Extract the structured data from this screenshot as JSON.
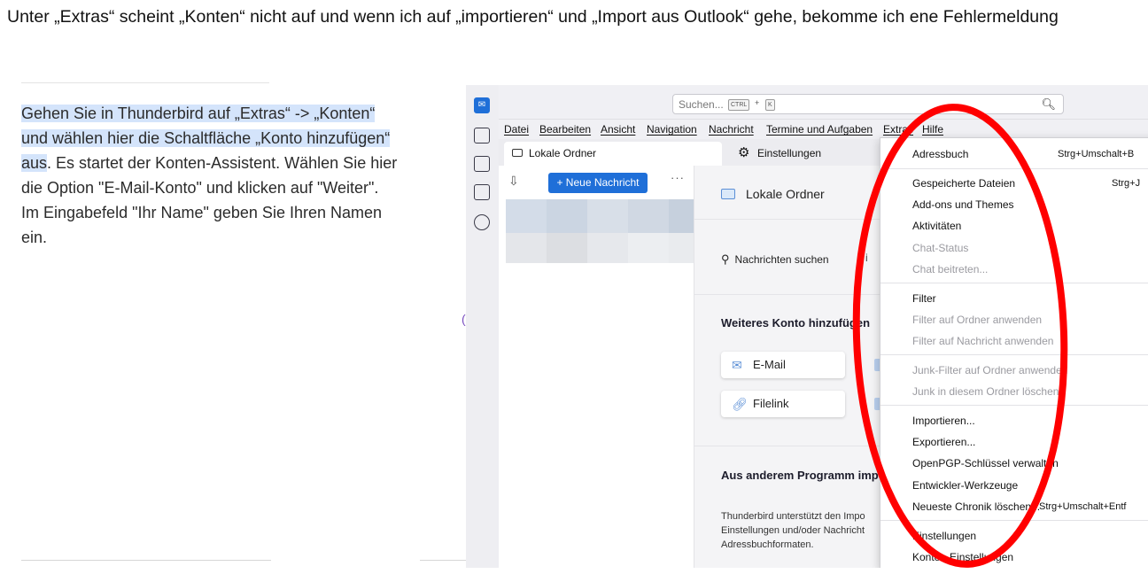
{
  "caption": "Unter „Extras“ scheint „Konten“ nicht auf und wenn ich auf „importieren“ und „Import aus Outlook“ gehe, bekomme ich ene Fehlermeldung",
  "help": {
    "line1": "Gehen Sie in Thunderbird auf „Extras“ -> „Konten“",
    "line2": "und wählen hier die Schaltfläche „Konto hinzufügen“",
    "line3a": "aus",
    "line3b": ". Es startet der Konten-Assistent. Wählen Sie hier",
    "line4": "die Option \"E-Mail-Konto\" und klicken auf \"Weiter\".",
    "line5": "Im Eingabefeld \"Ihr Name\" geben Sie Ihren Namen",
    "line6": "ein."
  },
  "toolbar": {
    "search_placeholder": "Suchen...",
    "kbd_ctrl": "CTRL",
    "kbd_plus": "+",
    "kbd_k": "K"
  },
  "menubar": [
    "Datei",
    "Bearbeiten",
    "Ansicht",
    "Navigation",
    "Nachricht",
    "Termine und Aufgaben",
    "Extras",
    "Hilfe"
  ],
  "tabs": {
    "folders": "Lokale Ordner",
    "settings": "Einstellungen"
  },
  "folderpane": {
    "new_message": "+ Neue Nachricht",
    "more": "···"
  },
  "content": {
    "folder_title": "Lokale Ordner",
    "search_messages": "Nachrichten suchen",
    "add_account": "Weiteres Konto hinzufügen",
    "email": "E-Mail",
    "filelink": "Filelink",
    "import_heading": "Aus anderem Programm imp",
    "import_desc_1": "Thunderbird unterstützt den Impo",
    "import_desc_2": "Einstellungen und/oder Nachricht",
    "import_desc_3": "Adressbuchformaten."
  },
  "dropdown": {
    "addressbook": "Adressbuch",
    "addressbook_sc": "Strg+Umschalt+B",
    "saved_files": "Gespeicherte Dateien",
    "saved_files_sc": "Strg+J",
    "addons": "Add-ons und Themes",
    "activities": "Aktivitäten",
    "chat_status": "Chat-Status",
    "chat_join": "Chat beitreten...",
    "filter": "Filter",
    "filter_folder": "Filter auf Ordner anwenden",
    "filter_message": "Filter auf Nachricht anwenden",
    "junk_filter": "Junk-Filter auf Ordner anwenden",
    "junk_delete": "Junk in diesem Ordner löschen",
    "import": "Importieren...",
    "export": "Exportieren...",
    "openpgp": "OpenPGP-Schlüssel verwalten",
    "devtools": "Entwickler-Werkzeuge",
    "history": "Neueste Chronik löschen...",
    "history_sc": "Strg+Umschalt+Entf",
    "settings": "Einstellungen",
    "account_settings": "Konten-Einstellungen"
  },
  "colors": {
    "accent": "#1f6fd8",
    "highlight": "#d4e4fb",
    "annotation": "#ff0000"
  }
}
